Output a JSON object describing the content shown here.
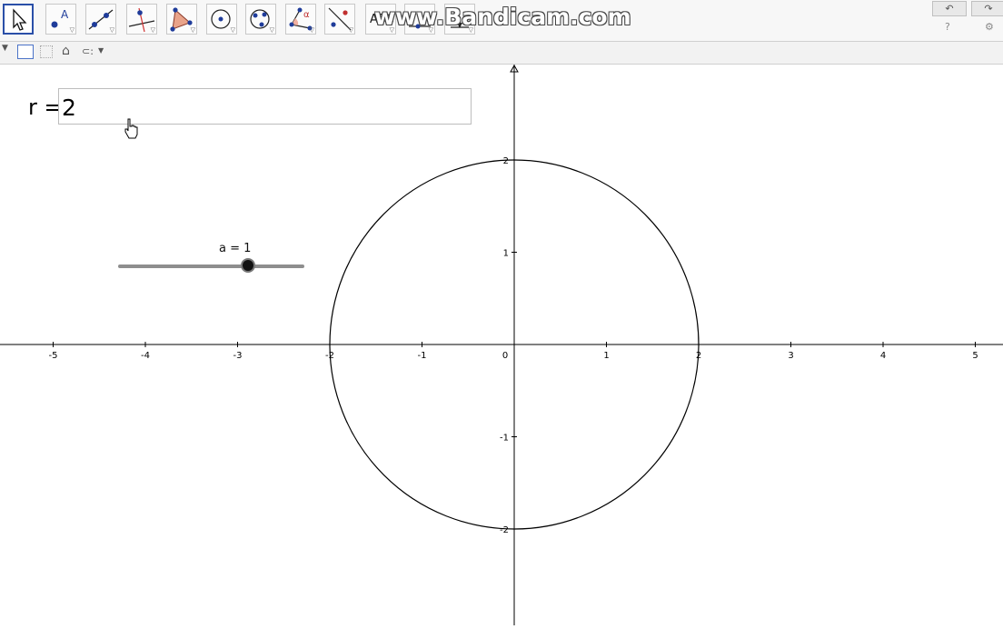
{
  "toolbar": {
    "tools": [
      {
        "name": "move-tool",
        "selected": true
      },
      {
        "name": "point-tool",
        "label": "A"
      },
      {
        "name": "line-tool"
      },
      {
        "name": "perpendicular-line-tool"
      },
      {
        "name": "polygon-tool"
      },
      {
        "name": "circle-center-point-tool"
      },
      {
        "name": "circle-three-points-tool"
      },
      {
        "name": "angle-tool",
        "label": "α"
      },
      {
        "name": "reflect-tool"
      },
      {
        "name": "text-tool",
        "label": "ABC"
      },
      {
        "name": "slider-tool"
      },
      {
        "name": "move-graphics-view-tool"
      }
    ],
    "undo_icon": "↶",
    "redo_icon": "↷",
    "help_icon": "?",
    "settings_icon": "⚙"
  },
  "watermark": "www.Bandicam.com",
  "stylebar": {
    "home_icon": "⌂",
    "point_capture_icon": "⊂:"
  },
  "input": {
    "label": "r =",
    "value": "2"
  },
  "slider": {
    "label": "a = 1",
    "value": 1,
    "min": -5,
    "max": 5
  },
  "graph": {
    "x_ticks": [
      "-5",
      "-4",
      "-3",
      "-2",
      "-1",
      "0",
      "1",
      "2",
      "3",
      "4",
      "5"
    ],
    "y_ticks": [
      "2",
      "1",
      "-1",
      "-2"
    ],
    "circle": {
      "center": [
        0,
        0
      ],
      "radius": 2
    },
    "axis_color": "#000000",
    "circle_color": "#000000"
  }
}
